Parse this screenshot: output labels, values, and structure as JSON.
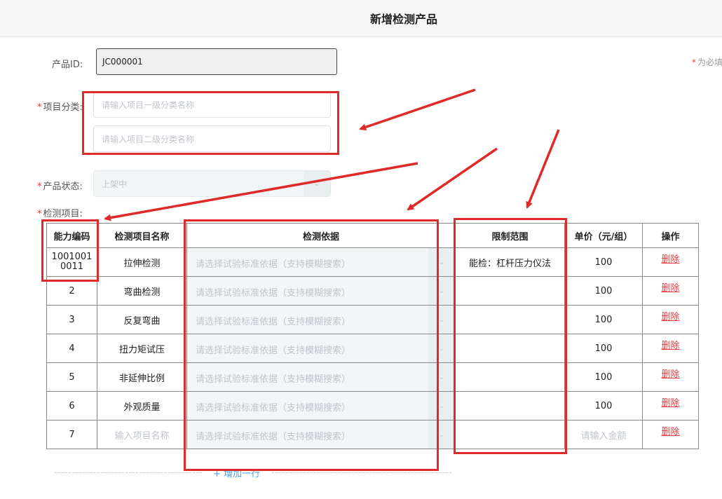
{
  "header": {
    "title": "新增检测产品"
  },
  "form": {
    "product_id": {
      "label": "产品ID:",
      "value": "JC000001"
    },
    "required_note": "为必填",
    "required_mark": "*",
    "category": {
      "label": "项目分类:",
      "level1_placeholder": "请输入项目一级分类名称",
      "level2_placeholder": "请输入项目二级分类名称"
    },
    "status": {
      "label": "产品状态:",
      "value": "上架中"
    },
    "items_label": "检测项目:"
  },
  "table": {
    "headers": [
      "能力编码",
      "检测项目名称",
      "检测依据",
      "限制范围",
      "单价（元/组）",
      "操作"
    ],
    "basis_placeholder": "请选择试验标准依据（支持模糊搜索）",
    "rows": [
      {
        "code": "10010010011",
        "name": "拉伸检测",
        "limit": "能检：杠杆压力仪法",
        "price": "100",
        "action": "删除"
      },
      {
        "code": "2",
        "name": "弯曲检测",
        "limit": "",
        "price": "100",
        "action": "删除"
      },
      {
        "code": "3",
        "name": "反复弯曲",
        "limit": "",
        "price": "100",
        "action": "删除"
      },
      {
        "code": "4",
        "name": "扭力矩试压",
        "limit": "",
        "price": "100",
        "action": "删除"
      },
      {
        "code": "5",
        "name": "非延伸比例",
        "limit": "",
        "price": "100",
        "action": "删除"
      },
      {
        "code": "6",
        "name": "外观质量",
        "limit": "",
        "price": "100",
        "action": "删除"
      },
      {
        "code": "7",
        "name": "",
        "limit": "",
        "price": "",
        "action": "删除"
      }
    ],
    "name_placeholder": "输入项目名称",
    "price_placeholder": "请输入金额",
    "add_row": "+ 增加一行"
  },
  "colors": {
    "annotation_red": "#e02a2a",
    "required_red": "#e4393c",
    "link_blue": "#409eff"
  }
}
